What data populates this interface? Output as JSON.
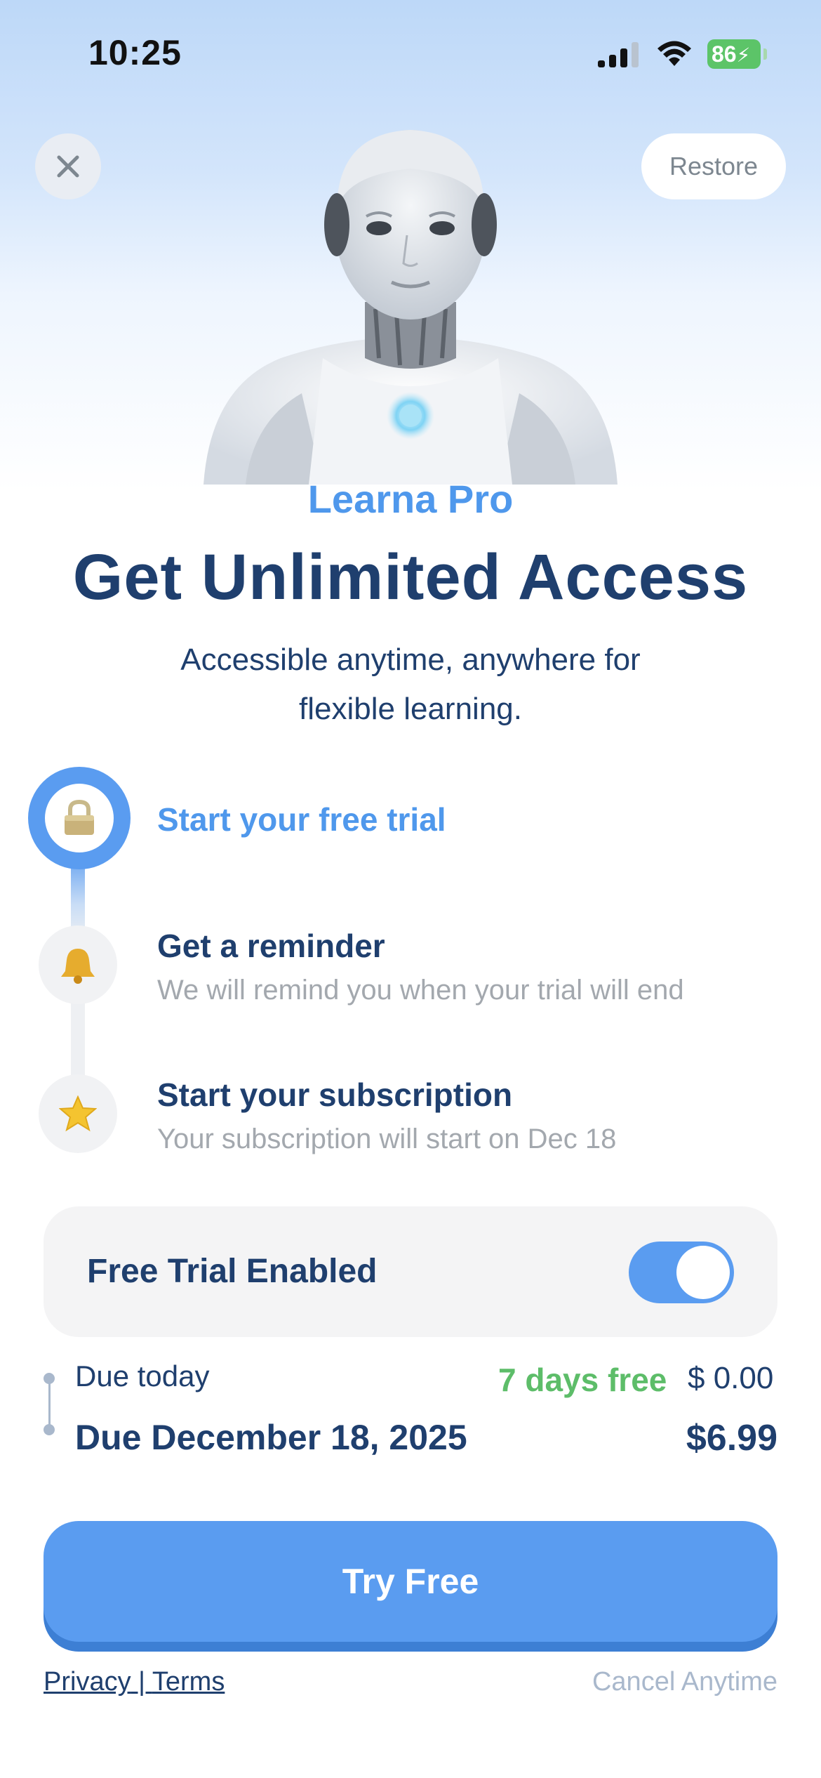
{
  "status_bar": {
    "time": "10:25",
    "battery": "86"
  },
  "header": {
    "restore_label": "Restore"
  },
  "brand": "Learna Pro",
  "headline": "Get Unlimited Access",
  "subtitle": "Accessible anytime, anywhere for flexible learning.",
  "steps": [
    {
      "title": "Start your free trial",
      "description": "",
      "icon": "lock-icon"
    },
    {
      "title": "Get a reminder",
      "description": "We will remind you when your trial will end",
      "icon": "bell-icon"
    },
    {
      "title": "Start your subscription",
      "description": "Your subscription will start on Dec 18",
      "icon": "star-icon"
    }
  ],
  "trial_toggle": {
    "label": "Free Trial Enabled",
    "enabled": true
  },
  "pricing": {
    "due_today_label": "Due today",
    "trial_badge": "7 days free",
    "due_today_amount": "$ 0.00",
    "due_later_label": "Due December 18, 2025",
    "due_later_amount": "$6.99"
  },
  "cta_label": "Try Free",
  "footer": {
    "privacy": "Privacy",
    "separator": " | ",
    "terms": "Terms",
    "cancel": "Cancel Anytime"
  },
  "colors": {
    "accent": "#5a9cf0",
    "navy": "#1f3f6e",
    "green": "#5dbd69",
    "muted": "#a3a8ae"
  }
}
